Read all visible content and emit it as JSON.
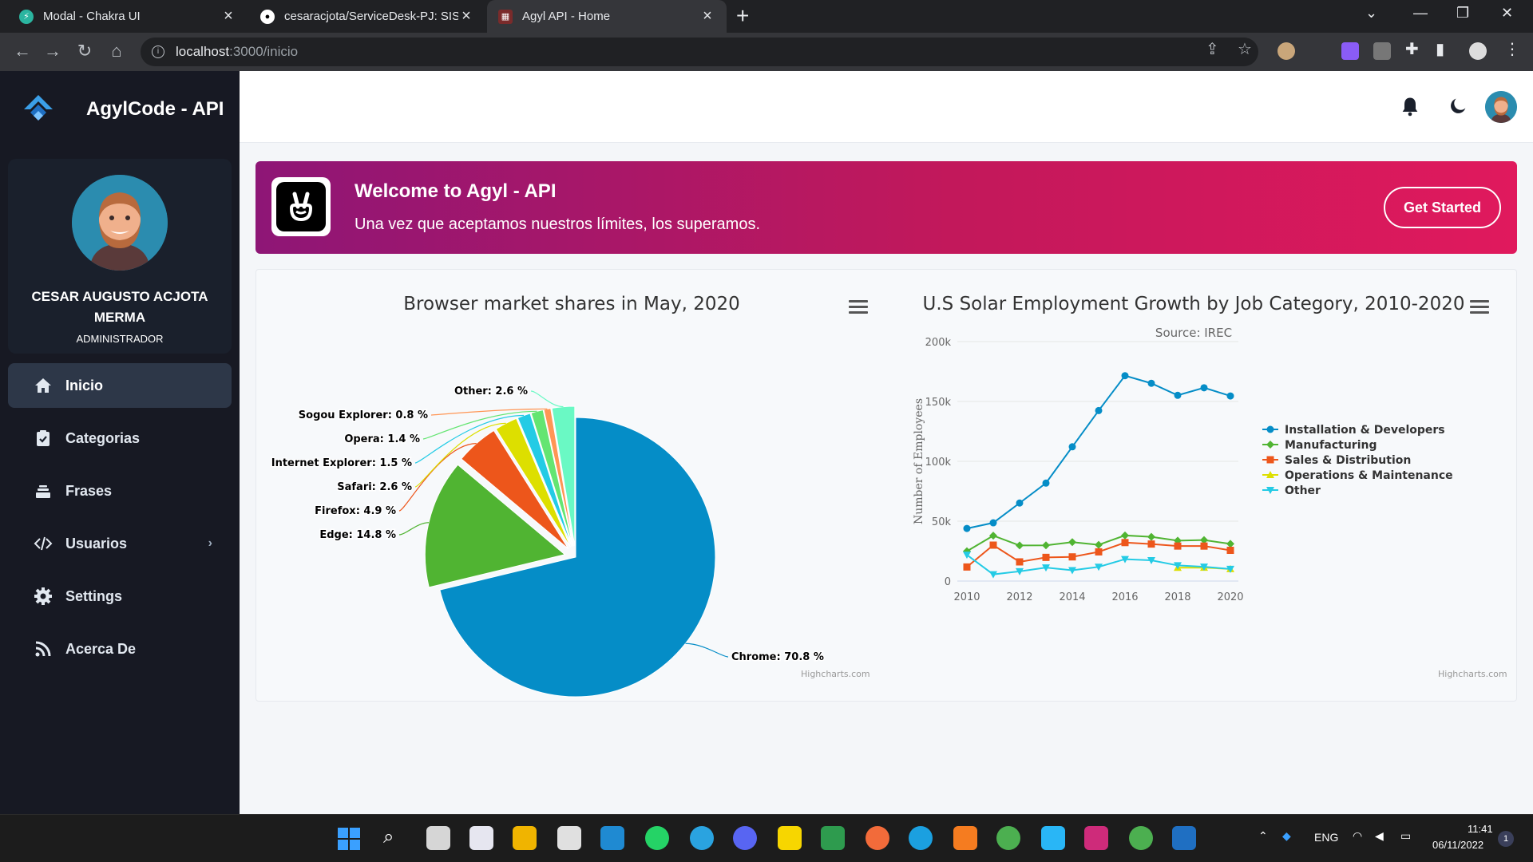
{
  "browser": {
    "tabs": [
      {
        "title": "Modal - Chakra UI",
        "icon": "chakra-icon"
      },
      {
        "title": "cesaracjota/ServiceDesk-PJ: SISTE",
        "icon": "github-icon"
      },
      {
        "title": "Agyl API - Home",
        "icon": "agyl-icon"
      }
    ],
    "url_host": "localhost",
    "url_path": ":3000/inicio"
  },
  "sidebar": {
    "brand": "AgylCode - API",
    "user_name": "CESAR AUGUSTO ACJOTA MERMA",
    "user_role": "ADMINISTRADOR",
    "items": [
      {
        "label": "Inicio",
        "icon": "home-icon",
        "active": true
      },
      {
        "label": "Categorias",
        "icon": "clipboard-icon"
      },
      {
        "label": "Frases",
        "icon": "stack-icon"
      },
      {
        "label": "Usuarios",
        "icon": "code-icon",
        "has_submenu": true
      },
      {
        "label": "Settings",
        "icon": "gear-icon"
      },
      {
        "label": "Acerca De",
        "icon": "rss-icon"
      }
    ]
  },
  "banner": {
    "title": "Welcome to Agyl - API",
    "subtitle": "Una vez que aceptamos nuestros límites, los superamos.",
    "button": "Get Started"
  },
  "chart_data": [
    {
      "type": "pie",
      "title": "Browser market shares in May, 2020",
      "credits": "Highcharts.com",
      "slices": [
        {
          "name": "Chrome",
          "label": "Chrome: 70.8 %",
          "value": 70.8,
          "color": "#058dc7",
          "sliced": false
        },
        {
          "name": "Edge",
          "label": "Edge: 14.8 %",
          "value": 14.8,
          "color": "#50b432",
          "sliced": true
        },
        {
          "name": "Firefox",
          "label": "Firefox: 4.9 %",
          "value": 4.9,
          "color": "#ed561b",
          "sliced": true
        },
        {
          "name": "Safari",
          "label": "Safari: 2.6 %",
          "value": 2.6,
          "color": "#dddf00",
          "sliced": true
        },
        {
          "name": "Internet Explorer",
          "label": "Internet Explorer: 1.5 %",
          "value": 1.5,
          "color": "#24cbe5",
          "sliced": true
        },
        {
          "name": "Opera",
          "label": "Opera: 1.4 %",
          "value": 1.4,
          "color": "#64e572",
          "sliced": true
        },
        {
          "name": "Sogou Explorer",
          "label": "Sogou Explorer: 0.8 %",
          "value": 0.8,
          "color": "#ff9655",
          "sliced": true
        },
        {
          "name": "Other",
          "label": "Other: 2.6 %",
          "value": 2.6,
          "color": "#6af9c4",
          "sliced": true
        }
      ]
    },
    {
      "type": "line",
      "title": "U.S Solar Employment Growth by Job Category, 2010-2020",
      "subtitle": "Source: IREC",
      "ylabel": "Number of Employees",
      "xlabel": "",
      "x": [
        2010,
        2011,
        2012,
        2013,
        2014,
        2015,
        2016,
        2017,
        2018,
        2019,
        2020
      ],
      "xticks": [
        "2010",
        "2012",
        "2014",
        "2016",
        "2018",
        "2020"
      ],
      "yticks": [
        "0",
        "50k",
        "100k",
        "150k",
        "200k"
      ],
      "ylim": [
        0,
        200000
      ],
      "legend_position": "right",
      "credits": "Highcharts.com",
      "series": [
        {
          "name": "Installation & Developers",
          "color": "#058dc7",
          "marker": "circle",
          "values": [
            43934,
            48656,
            65165,
            81827,
            112143,
            142383,
            171533,
            165174,
            155157,
            161454,
            154610
          ]
        },
        {
          "name": "Manufacturing",
          "color": "#50b432",
          "marker": "diamond",
          "values": [
            24916,
            37941,
            29742,
            29851,
            32490,
            30282,
            38121,
            36885,
            33726,
            34243,
            31050
          ]
        },
        {
          "name": "Sales & Distribution",
          "color": "#ed561b",
          "marker": "square",
          "values": [
            11744,
            30000,
            16005,
            19771,
            20185,
            24377,
            32147,
            30912,
            29243,
            29213,
            25663
          ]
        },
        {
          "name": "Operations & Maintenance",
          "color": "#dddf00",
          "marker": "triangle",
          "values": [
            null,
            null,
            null,
            null,
            null,
            null,
            null,
            null,
            11164,
            11218,
            10077
          ]
        },
        {
          "name": "Other",
          "color": "#24cbe5",
          "marker": "triangle-down",
          "values": [
            21908,
            5548,
            8105,
            11248,
            8989,
            11816,
            18274,
            17300,
            13053,
            11906,
            10073
          ]
        }
      ]
    }
  ],
  "taskbar": {
    "lang": "ENG",
    "time": "11:41",
    "date": "06/11/2022",
    "notifications": "1"
  }
}
